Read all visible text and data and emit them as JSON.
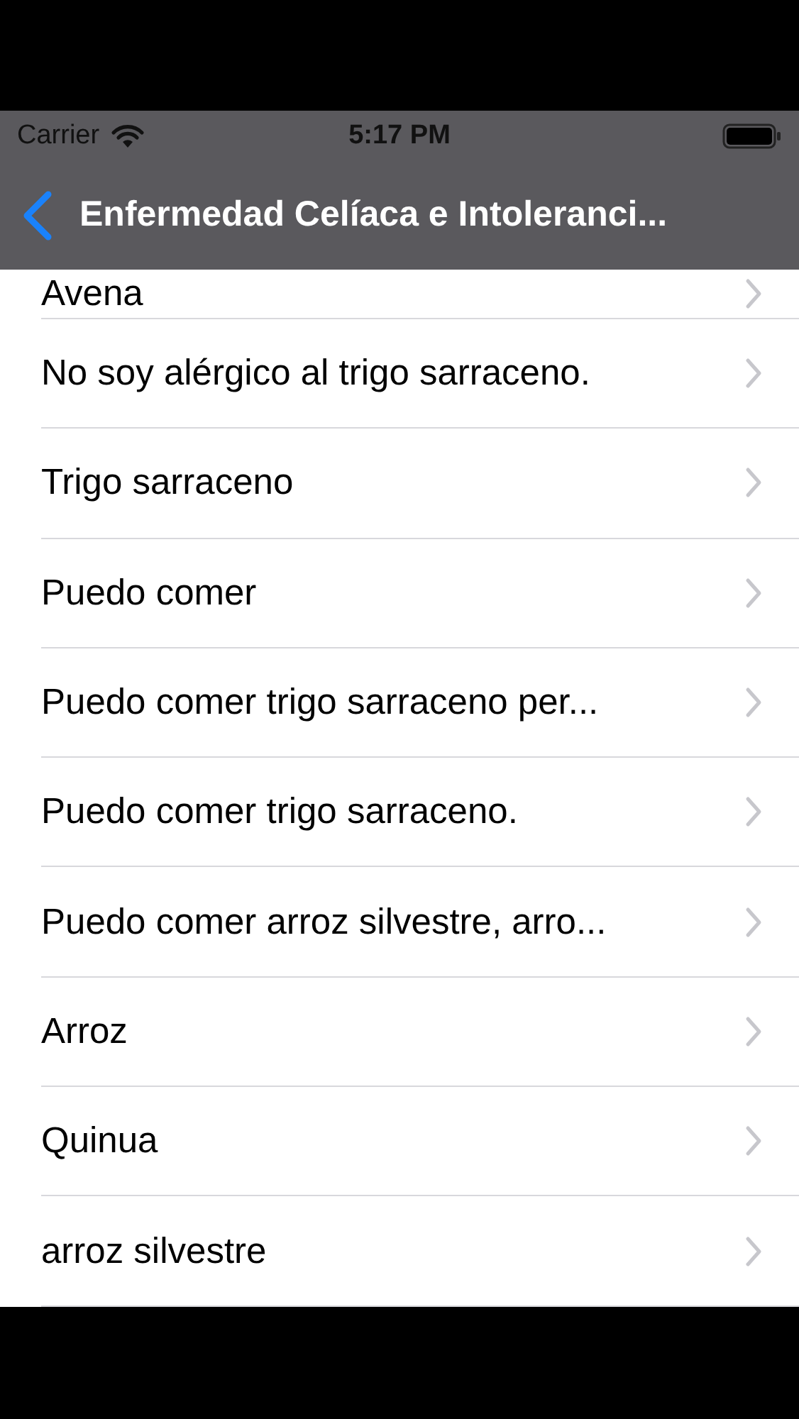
{
  "status_bar": {
    "carrier": "Carrier",
    "time": "5:17 PM"
  },
  "nav_bar": {
    "title": "Enfermedad Celíaca e Intoleranci..."
  },
  "list": [
    {
      "label": "Avena"
    },
    {
      "label": "No soy alérgico al trigo sarraceno."
    },
    {
      "label": "Trigo sarraceno"
    },
    {
      "label": "Puedo comer"
    },
    {
      "label": "Puedo comer trigo sarraceno per..."
    },
    {
      "label": "Puedo comer trigo sarraceno."
    },
    {
      "label": "Puedo comer arroz silvestre, arro..."
    },
    {
      "label": "Arroz"
    },
    {
      "label": "Quinua"
    },
    {
      "label": "arroz silvestre"
    }
  ]
}
